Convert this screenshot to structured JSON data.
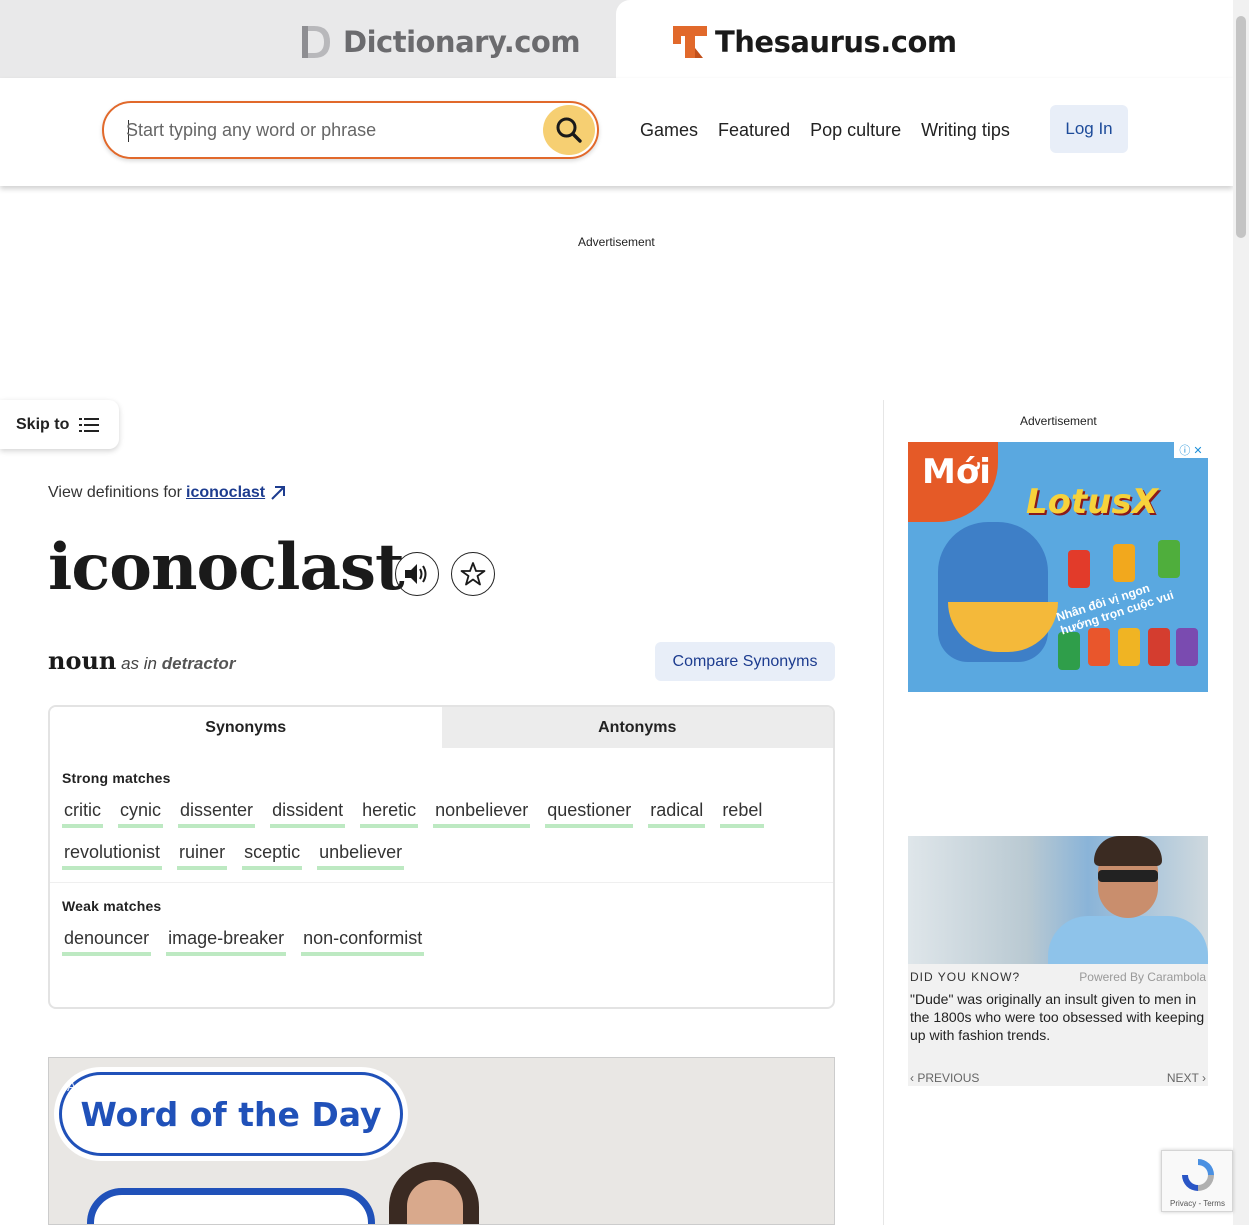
{
  "brand": {
    "dictionary": "Dictionary.com",
    "thesaurus": "Thesaurus.com",
    "accent": "#e1692b"
  },
  "search": {
    "placeholder": "Start typing any word or phrase",
    "button_color": "#f6cf72",
    "icon": "search-icon"
  },
  "nav": {
    "items": [
      "Games",
      "Featured",
      "Pop culture",
      "Writing tips"
    ],
    "login": "Log In"
  },
  "ads": {
    "top_label": "Advertisement",
    "side_label": "Advertisement",
    "side_ad": {
      "headline": "Mới",
      "brand": "LotusX",
      "slogan_line1": "Nhân đôi vị ngon",
      "slogan_line2": "hướng trọn cuộc vui"
    }
  },
  "skip_to": {
    "label": "Skip to",
    "icon": "list-icon"
  },
  "entry": {
    "view_defs_prefix": "View definitions for",
    "view_defs_word": "iconoclast",
    "headword": "iconoclast",
    "pos": "noun",
    "as_in": "as in",
    "sense": "detractor",
    "compare": "Compare Synonyms"
  },
  "tabs": {
    "synonyms": "Synonyms",
    "antonyms": "Antonyms"
  },
  "strong": {
    "title": "Strong matches",
    "words": [
      "critic",
      "cynic",
      "dissenter",
      "dissident",
      "heretic",
      "nonbeliever",
      "questioner",
      "radical",
      "rebel",
      "revolutionist",
      "ruiner",
      "sceptic",
      "unbeliever"
    ]
  },
  "weak": {
    "title": "Weak matches",
    "words": [
      "denouncer",
      "image-breaker",
      "non-conformist"
    ]
  },
  "video": {
    "caption": "Amanuensis, Word of the Day",
    "badge": "Word of the Day"
  },
  "did_you_know": {
    "label": "DID YOU KNOW?",
    "powered": "Powered By Carambola",
    "fact": "\"Dude\" was originally an insult given to men in the 1800s who were too obsessed with keeping up with fashion trends.",
    "prev": "PREVIOUS",
    "next": "NEXT"
  },
  "recaptcha": {
    "text": "Privacy - Terms"
  }
}
